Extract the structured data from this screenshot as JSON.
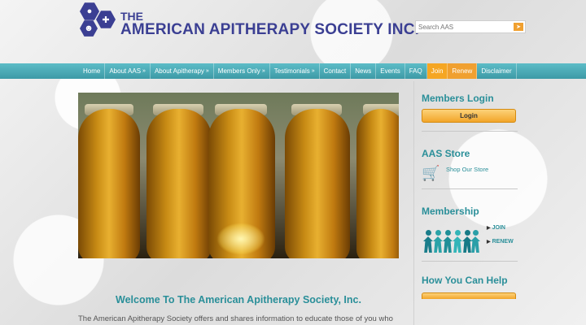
{
  "header": {
    "logo_the": "THE",
    "logo_title": "AMERICAN APITHERAPY SOCIETY INC.",
    "search": {
      "placeholder": "Search AAS",
      "button_icon": "search-icon"
    }
  },
  "nav": {
    "items": [
      {
        "label": "Home",
        "arrow": ""
      },
      {
        "label": "About AAS",
        "arrow": "»"
      },
      {
        "label": "About Apitherapy",
        "arrow": "»"
      },
      {
        "label": "Members Only",
        "arrow": "»"
      },
      {
        "label": "Testimonials",
        "arrow": "»"
      },
      {
        "label": "Contact",
        "arrow": ""
      },
      {
        "label": "News",
        "arrow": ""
      },
      {
        "label": "Events",
        "arrow": ""
      },
      {
        "label": "FAQ",
        "arrow": ""
      },
      {
        "label": "Join",
        "arrow": ""
      },
      {
        "label": "Renew",
        "arrow": ""
      },
      {
        "label": "Disclaimer",
        "arrow": ""
      }
    ]
  },
  "main": {
    "welcome_title": "Welcome To The American Apitherapy Society, Inc.",
    "intro_text": "The American Apitherapy Society offers and shares information to educate those of you who"
  },
  "sidebar": {
    "members_login": {
      "heading": "Members Login",
      "button": "Login"
    },
    "store": {
      "heading": "AAS Store",
      "link": "Shop Our Store"
    },
    "membership": {
      "heading": "Membership",
      "join": "JOIN",
      "renew": "RENEW"
    },
    "help": {
      "heading": "How You Can Help"
    }
  },
  "colors": {
    "brand": "#3b3f93",
    "accent_teal": "#2a8f99",
    "nav_teal": "#4aaab5",
    "button_orange": "#f2a52a"
  }
}
